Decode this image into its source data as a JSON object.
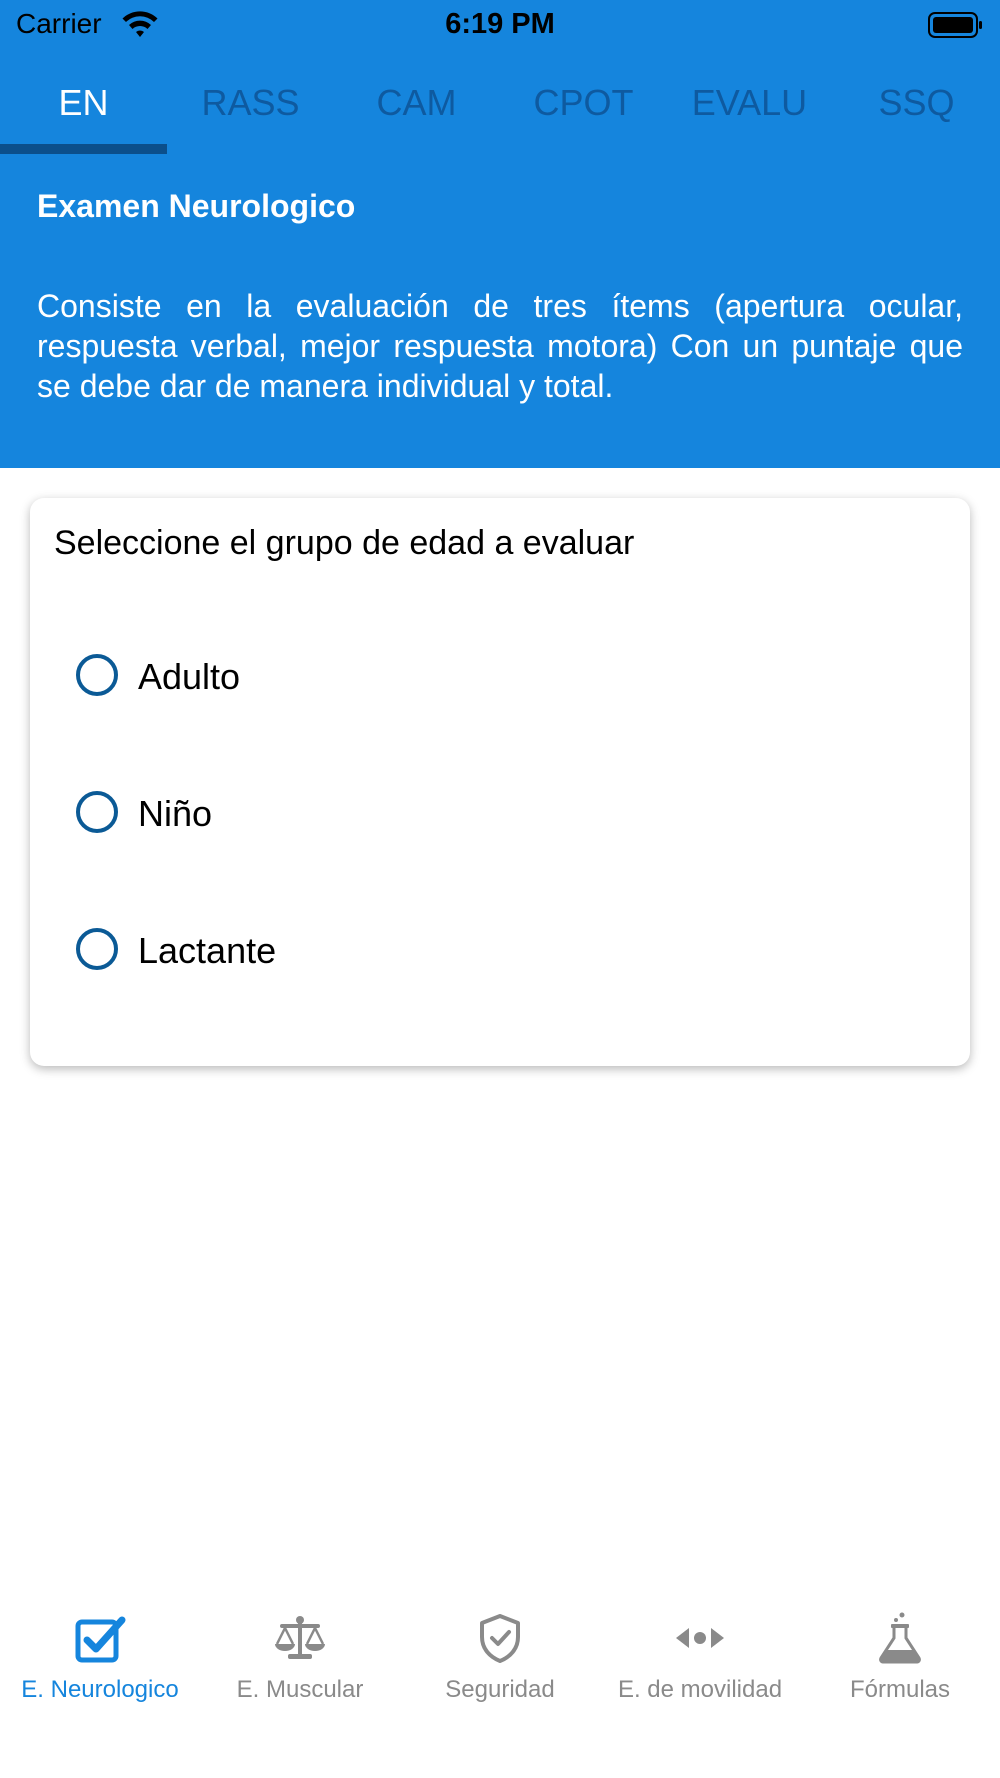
{
  "status_bar": {
    "carrier": "Carrier",
    "time": "6:19 PM"
  },
  "top_tabs": [
    {
      "label": "EN",
      "active": true
    },
    {
      "label": "RASS",
      "active": false
    },
    {
      "label": "CAM",
      "active": false
    },
    {
      "label": "CPOT",
      "active": false
    },
    {
      "label": "EVALU",
      "active": false
    },
    {
      "label": "SSQ",
      "active": false
    }
  ],
  "section": {
    "title": "Examen Neurologico",
    "description": "Consiste en la evaluación de tres ítems (apertura ocular, respuesta verbal, mejor respuesta motora) Con un puntaje que se debe dar de manera individual y total."
  },
  "card": {
    "title": "Seleccione el grupo de edad a evaluar",
    "options": [
      {
        "label": "Adulto",
        "selected": false
      },
      {
        "label": "Niño",
        "selected": false
      },
      {
        "label": "Lactante",
        "selected": false
      }
    ]
  },
  "tab_bar": [
    {
      "label": "E. Neurologico",
      "icon": "checkbox-checked-icon",
      "active": true
    },
    {
      "label": "E. Muscular",
      "icon": "balance-scale-icon",
      "active": false
    },
    {
      "label": "Seguridad",
      "icon": "shield-check-icon",
      "active": false
    },
    {
      "label": "E. de movilidad",
      "icon": "arrows-horizontal-icon",
      "active": false
    },
    {
      "label": "Fórmulas",
      "icon": "flask-icon",
      "active": false
    }
  ],
  "colors": {
    "header_blue": "#1585dd",
    "tab_indicator": "#0b4f8b",
    "radio_border": "#0b5a96",
    "inactive_gray": "#8a8a8a"
  }
}
